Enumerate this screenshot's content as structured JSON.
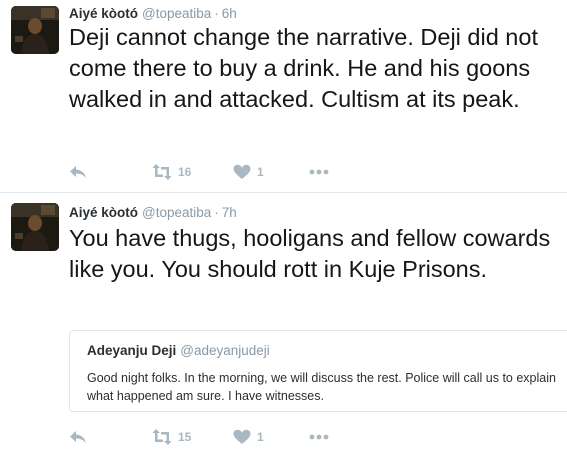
{
  "tweets": [
    {
      "author": {
        "name": "Aiyé kòotó",
        "handle": "@topeatiba"
      },
      "separator": "·",
      "time": "6h",
      "text": "Deji cannot change the narrative. Deji did not come there to buy a drink. He and his goons walked in and attacked. Cultism at its peak.",
      "actions": {
        "reply_icon": "reply-icon",
        "retweet_icon": "retweet-icon",
        "retweet_count": "16",
        "like_icon": "heart-icon",
        "like_count": "1",
        "more_icon": "more-dots-icon"
      }
    },
    {
      "author": {
        "name": "Aiyé kòotó",
        "handle": "@topeatiba"
      },
      "separator": "·",
      "time": "7h",
      "text": "You have thugs, hooligans and fellow cowards like you. You should rott in Kuje Prisons.",
      "quoted": {
        "name": "Adeyanju Deji",
        "handle": "@adeyanjudeji",
        "text": "Good night folks. In the morning, we will discuss the rest. Police will call us to explain what happened am sure. I have witnesses."
      },
      "actions": {
        "reply_icon": "reply-icon",
        "retweet_icon": "retweet-icon",
        "retweet_count": "15",
        "like_icon": "heart-icon",
        "like_count": "1",
        "more_icon": "more-dots-icon"
      }
    }
  ],
  "colors": {
    "name_text": "#292f33",
    "meta_text": "#8899a6",
    "body_text": "#14171a",
    "action_icon": "#aab8c2",
    "border": "#e1e8ed"
  }
}
